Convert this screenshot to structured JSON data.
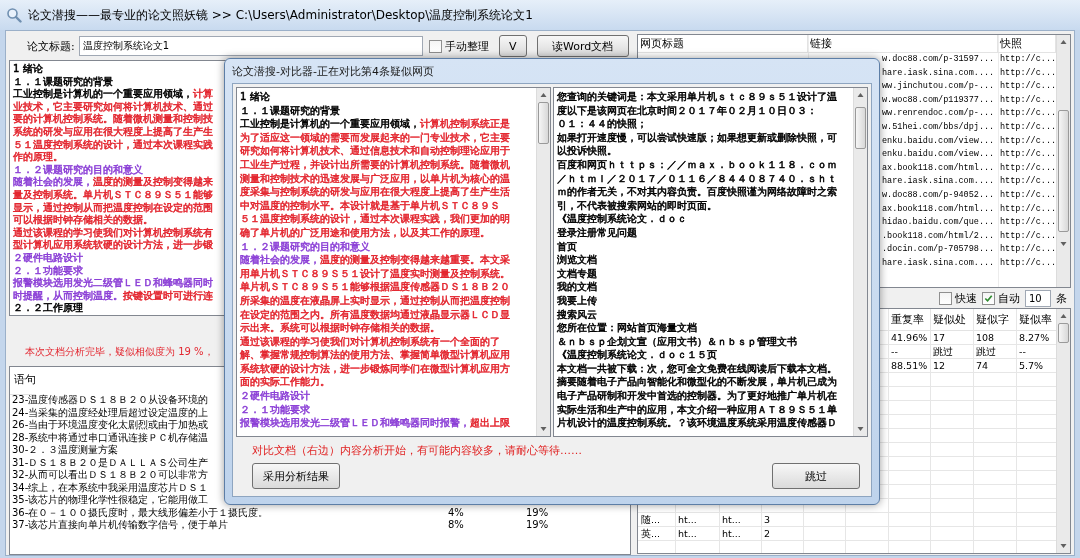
{
  "window": {
    "title": "论文潜搜——最专业的论文照妖镜 >> C:\\Users\\Administrator\\Desktop\\温度控制系统论文1"
  },
  "paper_title": {
    "label": "论文标题:",
    "value": "温度控制系统论文1"
  },
  "manual_checkbox": {
    "label": "手动整理",
    "checked": false
  },
  "buttons": [
    {
      "label": "V"
    },
    {
      "label": "读Word文档"
    }
  ],
  "document": {
    "lines": [
      {
        "runs": [
          {
            "text": "1 绪论",
            "color": "#000000"
          }
        ]
      },
      {
        "runs": [
          {
            "text": "１．１课题研究的背景",
            "color": "#000000"
          }
        ]
      },
      {
        "runs": [
          {
            "text": "工业控制是计算机的一个重要应用领域，",
            "color": "#000000"
          },
          {
            "text": "计算",
            "color": "#e3262f"
          }
        ]
      },
      {
        "runs": [
          {
            "text": "业技术，它主要研究如何将计算机技术、通过",
            "color": "#e3262f"
          }
        ]
      },
      {
        "runs": [
          {
            "text": "要的计算机控制系统。随着微机测量和控制技",
            "color": "#e3262f"
          }
        ]
      },
      {
        "runs": [
          {
            "text": "系统的研发与应用在很大程度上提高了生产生",
            "color": "#e3262f"
          }
        ]
      },
      {
        "runs": [
          {
            "text": "５１温度控制系统的设计，通过本次课程实践",
            "color": "#e3262f"
          }
        ]
      },
      {
        "runs": [
          {
            "text": "作的原理。",
            "color": "#e3262f"
          }
        ]
      },
      {
        "runs": [
          {
            "text": "１．２课题研究的目的和意义",
            "color": "#8b3fd6"
          }
        ]
      },
      {
        "runs": [
          {
            "text": "随着社会的发展，",
            "color": "#8b3fd6"
          },
          {
            "text": "温度的测量及控制变得越来",
            "color": "#e3262f"
          }
        ]
      },
      {
        "runs": [
          {
            "text": "量及控制系统。单片机ＳＴＣ８９Ｓ５１能够",
            "color": "#e3262f"
          }
        ]
      },
      {
        "runs": [
          {
            "text": "显示，通过控制从而把温度控制在设定的范围",
            "color": "#e3262f"
          }
        ]
      },
      {
        "runs": [
          {
            "text": "可以根据时钟存储相关的数据。",
            "color": "#e3262f"
          }
        ]
      },
      {
        "runs": [
          {
            "text": "通过该课程的学习使我们对计算机控制系统有",
            "color": "#e3262f"
          }
        ]
      },
      {
        "runs": [
          {
            "text": "型计算机应用系统软硬的设计方法，进一步锻",
            "color": "#e3262f"
          }
        ]
      },
      {
        "runs": [
          {
            "text": "２硬件电路设计",
            "color": "#8b3fd6"
          }
        ]
      },
      {
        "runs": [
          {
            "text": "２．１功能要求",
            "color": "#8b3fd6"
          }
        ]
      },
      {
        "runs": [
          {
            "text": "报警模块选用发光二级管ＬＥＤ和蜂鸣器同时",
            "color": "#8b3fd6"
          }
        ]
      },
      {
        "runs": [
          {
            "text": "时提醒，从而控制温度。",
            "color": "#8b3fd6"
          },
          {
            "text": "按键设置时可进行连",
            "color": "#e3262f"
          }
        ]
      },
      {
        "runs": [
          {
            "text": "２．２工作原理",
            "color": "#000000"
          }
        ]
      }
    ]
  },
  "status_message": "本次文档分析完毕，疑似相似度为 19 %，",
  "sentence_table": {
    "columns": [
      "语句"
    ],
    "rows": [
      {
        "cells": [
          "23-温度传感器ＤＳ１８Ｂ２０从设备环境的"
        ]
      },
      {
        "cells": [
          "24-当采集的温度经处理后超过设定温度的上"
        ]
      },
      {
        "cells": [
          "26-当由于环境温度变化太剧烈或由于加热或"
        ]
      },
      {
        "cells": [
          "28-系统中将通过串口通讯连接ＰＣ机存储温"
        ]
      },
      {
        "cells": [
          "30-２．３温度测量方案"
        ]
      },
      {
        "cells": [
          "31-ＤＳ１８Ｂ２０是ＤＡＬＬＡＳ公司生产"
        ]
      },
      {
        "cells": [
          "32-从而可以看出ＤＳ１８Ｂ２０可以非常方"
        ]
      },
      {
        "cells": [
          "34-综上，在本系统中我采用温度芯片ＤＳ１"
        ]
      },
      {
        "cells": [
          "35-该芯片的物理化学性很稳定，它能用做工"
        ]
      },
      {
        "cells": [
          "36-在０－１００摄氏度时，最大线形偏差小于１摄氏度。",
          "4%",
          "19%"
        ]
      },
      {
        "cells": [
          "37-该芯片直接向单片机传输数字信号，便于单片",
          "8%",
          "19%"
        ]
      }
    ]
  },
  "web_table": {
    "columns": [
      "网页标题",
      "链接",
      "快照"
    ],
    "rows": [
      {
        "link": "w.doc88.com/p-31597...",
        "snapshot": "http://c..."
      },
      {
        "link": "hare.iask.sina.com....",
        "snapshot": "http://c..."
      },
      {
        "link": "ww.jinchutou.com/p-...",
        "snapshot": "http://c..."
      },
      {
        "link": "w.woc88.com/p119377...",
        "snapshot": "http://c..."
      },
      {
        "link": "ww.renrendoc.com/p-...",
        "snapshot": "http://c..."
      },
      {
        "link": "w.51hei.com/bbs/dpj...",
        "snapshot": "http://c..."
      },
      {
        "link": "enku.baidu.com/view...",
        "snapshot": "http://c..."
      },
      {
        "link": "enku.baidu.com/view...",
        "snapshot": "http://c..."
      },
      {
        "link": "ax.book118.com/html...",
        "snapshot": "http://c..."
      },
      {
        "link": "hare.iask.sina.com....",
        "snapshot": "http://c..."
      },
      {
        "link": "w.doc88.com/p-94052...",
        "snapshot": "http://c..."
      },
      {
        "link": "ax.book118.com/html...",
        "snapshot": "http://c..."
      },
      {
        "link": "hidao.baidu.com/que...",
        "snapshot": "http://c..."
      },
      {
        "link": ".book118.com/html/2...",
        "snapshot": "http://c..."
      },
      {
        "link": ".docin.com/p-705798...",
        "snapshot": "http://c..."
      },
      {
        "link": "hare.iask.sina.com....",
        "snapshot": "http://c..."
      }
    ]
  },
  "options": {
    "checkboxes": [
      {
        "label": "快速",
        "checked": false
      },
      {
        "label": "自动",
        "checked": true
      }
    ],
    "count": "10",
    "unit": "条"
  },
  "results_table": {
    "columns": [
      "重复率",
      "疑似处",
      "疑似字",
      "疑似率"
    ],
    "rows": [
      {
        "kind": "right_part",
        "cells": [
          "41.96%",
          "17",
          "108",
          "8.27%"
        ]
      },
      {
        "kind": "right_part",
        "cells": [
          "--",
          "跳过",
          "跳过",
          "--"
        ]
      },
      {
        "kind": "right_part",
        "cells": [
          "88.51%",
          "12",
          "74",
          "5.7%"
        ]
      },
      {
        "kind": "left_part",
        "cells": [
          "随...",
          "ht...",
          "ht...",
          "3"
        ]
      },
      {
        "kind": "left_part",
        "cells": [
          "英...",
          "ht...",
          "ht...",
          "2"
        ]
      }
    ]
  },
  "dialog": {
    "title": "论文潜搜-对比器-正在对比第4条疑似网页",
    "left_lines": [
      {
        "runs": [
          {
            "text": "1 绪论",
            "color": "#000000"
          }
        ]
      },
      {
        "runs": [
          {
            "text": "１．１课题研究的背景",
            "color": "#000000"
          }
        ]
      },
      {
        "runs": [
          {
            "text": "工业控制是计算机的一个重要应用领域，",
            "color": "#000000"
          },
          {
            "text": "计算机控制系统正是",
            "color": "#e3262f"
          }
        ]
      },
      {
        "runs": [
          {
            "text": "为了适应这一领域的需要而发展起来的一门专业技术，它主要",
            "color": "#e3262f"
          }
        ]
      },
      {
        "runs": [
          {
            "text": "研究如何将计算机技术、通过信息技术和自动控制理论应用于",
            "color": "#e3262f"
          }
        ]
      },
      {
        "runs": [
          {
            "text": "工业生产过程，并设计出所需要的计算机控制系统。随着微机",
            "color": "#e3262f"
          }
        ]
      },
      {
        "runs": [
          {
            "text": "测量和控制技术的迅速发展与广泛应用，以单片机为核心的温",
            "color": "#e3262f"
          }
        ]
      },
      {
        "runs": [
          {
            "text": "度采集与控制系统的研发与应用在很大程度上提高了生产生活",
            "color": "#e3262f"
          }
        ]
      },
      {
        "runs": [
          {
            "text": "中对温度的控制水平。本设计就是基于单片机ＳＴＣ８９Ｓ",
            "color": "#e3262f"
          }
        ]
      },
      {
        "runs": [
          {
            "text": "５１温度控制系统的设计，通过本次课程实践，我们更加的明",
            "color": "#e3262f"
          }
        ]
      },
      {
        "runs": [
          {
            "text": "确了单片机的广泛用途和使用方法，以及其工作的原理。",
            "color": "#e3262f"
          }
        ]
      },
      {
        "runs": [
          {
            "text": "１．２课题研究的目的和意义",
            "color": "#8b3fd6"
          }
        ]
      },
      {
        "runs": [
          {
            "text": "随着社会的发展，",
            "color": "#8b3fd6"
          },
          {
            "text": "温度的测量及控制变得越来越重要。本文采",
            "color": "#e3262f"
          }
        ]
      },
      {
        "runs": [
          {
            "text": "用单片机ＳＴＣ８９Ｓ５１设计了温度实时测量及控制系统。",
            "color": "#e3262f"
          }
        ]
      },
      {
        "runs": [
          {
            "text": "单片机ＳＴＣ８９Ｓ５１能够根据温度传感器ＤＳ１８Ｂ２０",
            "color": "#e3262f"
          }
        ]
      },
      {
        "runs": [
          {
            "text": "所采集的温度在液晶屏上实时显示，通过控制从而把温度控制",
            "color": "#e3262f"
          }
        ]
      },
      {
        "runs": [
          {
            "text": "在设定的范围之内。所有温度数据均通过液晶显示器ＬＣＤ显",
            "color": "#e3262f"
          }
        ]
      },
      {
        "runs": [
          {
            "text": "示出来。系统可以根据时钟存储相关的数据。",
            "color": "#e3262f"
          }
        ]
      },
      {
        "runs": [
          {
            "text": "通过该课程的学习使我们对计算机控制系统有一个全面的了",
            "color": "#e3262f"
          }
        ]
      },
      {
        "runs": [
          {
            "text": "解、掌握常规控制算法的使用方法、掌握简单微型计算机应用",
            "color": "#e3262f"
          }
        ]
      },
      {
        "runs": [
          {
            "text": "系统软硬的设计方法，进一步锻炼同学们在微型计算机应用方",
            "color": "#e3262f"
          }
        ]
      },
      {
        "runs": [
          {
            "text": "面的实际工作能力。",
            "color": "#e3262f"
          }
        ]
      },
      {
        "runs": [
          {
            "text": "２硬件电路设计",
            "color": "#8b3fd6"
          }
        ]
      },
      {
        "runs": [
          {
            "text": "２．１功能要求",
            "color": "#8b3fd6"
          }
        ]
      },
      {
        "runs": [
          {
            "text": "报警模块选用发光二级管ＬＥＤ和蜂鸣器同时报警，",
            "color": "#8b3fd6"
          },
          {
            "text": "超出上限",
            "color": "#e3262f"
          }
        ]
      }
    ],
    "right_lines": [
      "您查询的关键词是：本文采用单片机ｓｔｃ８９ｓ５１设计了温",
      "度以下是该网页在北京时间２０１７年０２月１０日０３：",
      "０１：４４的快照；",
      "如果打开速度慢，可以尝试快速版；如果想更新或删除快照，可",
      "以投诉快照。",
      "百度和网页ｈｔｔｐｓ：／／ｍａｘ．ｂｏｏｋ１１８．ｃｏｍ",
      "／ｈｔｍｌ／２０１７／０１１６／８４４０８７４０．ｓｈｔ",
      "ｍ的作者无关，不对其内容负责。百度快照谨为网络故障时之索",
      "引，不代表被搜索网站的即时页面。",
      "《温度控制系统论文．ｄｏｃ",
      "登录注册常见问题",
      "首页",
      "浏览文档",
      "文档专题",
      "我的文档",
      "我要上传",
      "搜索风云",
      "您所在位置：网站首页海量文档",
      "＆ｎｂｓｐ企划文宣（应用文书）＆ｎｂｓｐ管理文书",
      "《温度控制系统论文．ｄｏｃ１５页",
      "本文档一共被下载：次，您可全文免费在线阅读后下载本文档。",
      "摘要随着电子产品向智能化和微型化的不断发展，单片机已成为",
      "电子产品研制和开发中首选的控制器。为了更好地推广单片机在",
      "实际生活和生产中的应用，本文介绍一种应用ＡＴ８９Ｓ５１单",
      "片机设计的温度控制系统。？该环境温度系统采用温度传感器Ｄ"
    ],
    "message": "对比文档（右边）内容分析开始，有可能内容较多，请耐心等待……",
    "buttons": [
      "采用分析结果",
      "跳过"
    ]
  }
}
